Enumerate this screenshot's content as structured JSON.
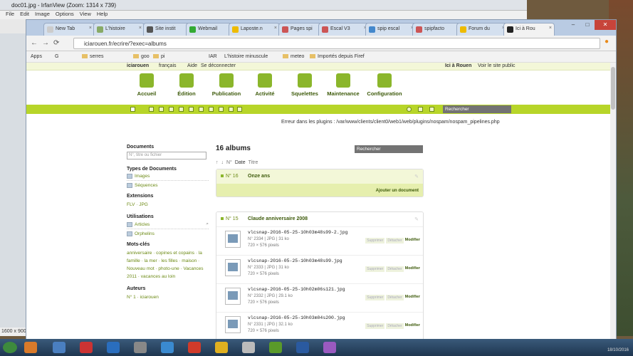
{
  "irfanview": {
    "title": "doc01.jpg - IrfanView (Zoom: 1314 x 739)",
    "menu": [
      "File",
      "Edit",
      "Image",
      "Options",
      "View",
      "Help"
    ],
    "status": "1600 x 900"
  },
  "browser": {
    "tabs": [
      {
        "label": "New Tab"
      },
      {
        "label": "L'histoire"
      },
      {
        "label": "Site instit"
      },
      {
        "label": "Webmail"
      },
      {
        "label": "Laposte.n"
      },
      {
        "label": "Pages spi"
      },
      {
        "label": "Escal V3"
      },
      {
        "label": "spip escal"
      },
      {
        "label": "spipfacto"
      },
      {
        "label": "Forum du"
      },
      {
        "label": "Ici à Rou"
      }
    ],
    "url": "iciarouen.fr/ecrire/?exec=albums",
    "bookmarks": [
      "Apps",
      "G",
      "serres",
      "goo",
      "pi",
      "IAR",
      "L'histoire minuscule",
      "meteo",
      "Importés depuis Firef"
    ]
  },
  "spipbar": {
    "site": "iciarouen",
    "lang": "français",
    "help": "Aide",
    "logout": "Se déconnecter",
    "site_name": "Ici à Rouen",
    "visit": "Voir le site public"
  },
  "nav": [
    {
      "label": "Accueil"
    },
    {
      "label": "Édition"
    },
    {
      "label": "Publication"
    },
    {
      "label": "Activité"
    },
    {
      "label": "Squelettes"
    },
    {
      "label": "Maintenance"
    },
    {
      "label": "Configuration"
    }
  ],
  "greenbar": {
    "search_placeholder": "Rechercher"
  },
  "error": "Erreur dans les plugins : /var/www/clients/client0/web1/web/plugins/nospam/nospam_pipelines.php",
  "sidebar": {
    "documents_h": "Documents",
    "doc_placeholder": "N°, titre ou fichier",
    "types_h": "Types de Documents",
    "images": "Images",
    "sequences": "Séquences",
    "ext_h": "Extensions",
    "ext": "FLV · JPG",
    "util_h": "Utilisations",
    "articles": "Articles",
    "orphelins": "Orphelins",
    "mots_h": "Mots-clés",
    "mots": "anniversaire · copines et copains · la famille · la mer · les filles · maison · Nouveau mot · photo-une · Vacances 2011 · vacances au loin",
    "auteurs_h": "Auteurs",
    "auteur": "N° 1 · iciarouen"
  },
  "main": {
    "heading": "16 albums",
    "search_placeholder": "Rechercher",
    "sort": [
      "↑",
      "↓",
      "N°",
      "Date",
      "Titre"
    ],
    "albums": [
      {
        "num": "N° 16",
        "title": "Onze ans",
        "action": "Ajouter un document"
      },
      {
        "num": "N° 15",
        "title": "Claude anniversaire 2008"
      }
    ],
    "docs": [
      {
        "name": "vlcsnap-2016-05-25-10h03m48s99-2.jpg",
        "meta": "N° 2334  |  JPG  |  31 ko",
        "dim": "720 × 576 pixels"
      },
      {
        "name": "vlcsnap-2016-05-25-10h03m48s99.jpg",
        "meta": "N° 2333  |  JPG  |  31 ko",
        "dim": "720 × 576 pixels"
      },
      {
        "name": "vlcsnap-2016-05-25-10h02m06s121.jpg",
        "meta": "N° 2332  |  JPG  |  29.1 ko",
        "dim": "720 × 576 pixels"
      },
      {
        "name": "vlcsnap-2016-05-25-10h03m04s200.jpg",
        "meta": "N° 2331  |  JPG  |  32.1 ko",
        "dim": "720 × 576 pixels"
      }
    ],
    "doc_actions": {
      "a": "Supprimer",
      "b": "Détacher",
      "c": "Modifier"
    }
  },
  "taskbar": {
    "date": "18/10/2016"
  }
}
